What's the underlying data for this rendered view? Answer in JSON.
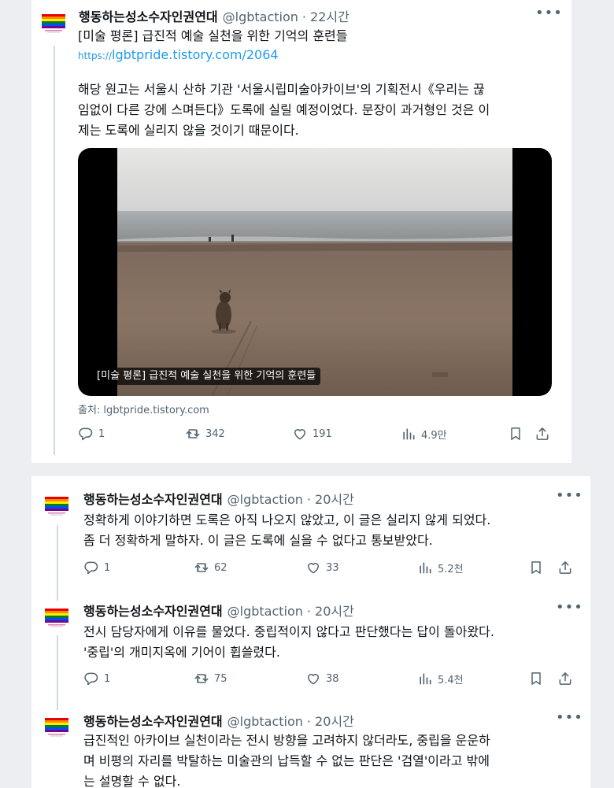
{
  "tweet1": {
    "name": "행동하는성소수자인권연대",
    "handle": "@lgbtaction",
    "time": "22시간",
    "title": "[미술 평론] 급진적 예술 실천을 위한 기억의 훈련들",
    "link_prefix": "https://",
    "link": "lgbtpride.tistory.com/2064",
    "body_line1": "해당 원고는 서울시 산하 기관 '서울시립미술아카이브'의 기획전시《우리는 끊",
    "body_line2": "임없이 다른 강에 스며든다》도록에 실릴 예정이었다. 문장이 과거형인 것은 이",
    "body_line3": "제는 도록에 실리지 않을 것이기 때문이다.",
    "media_caption": "[미술 평론] 급진적 예술 실천을 위한 기억의 훈련들",
    "source": "출처: lgbtpride.tistory.com",
    "replies": "1",
    "retweets": "342",
    "likes": "191",
    "views": "4.9만"
  },
  "tweet2": {
    "name": "행동하는성소수자인권연대",
    "handle": "@lgbtaction",
    "time": "20시간",
    "body_line1": "정확하게 이야기하면 도록은 아직 나오지 않았고, 이 글은 실리지 않게 되었다.",
    "body_line2": "좀 더 정확하게 말하자. 이 글은 도록에 실을 수 없다고 통보받았다.",
    "replies": "1",
    "retweets": "62",
    "likes": "33",
    "views": "5.2천"
  },
  "tweet3": {
    "name": "행동하는성소수자인권연대",
    "handle": "@lgbtaction",
    "time": "20시간",
    "body_line1": "전시 담당자에게 이유를 물었다. 중립적이지 않다고 판단했다는 답이 돌아왔다.",
    "body_line2": "'중립'의 개미지옥에 기어이 휩쓸렸다.",
    "replies": "1",
    "retweets": "75",
    "likes": "38",
    "views": "5.4천"
  },
  "tweet4": {
    "name": "행동하는성소수자인권연대",
    "handle": "@lgbtaction",
    "time": "20시간",
    "body_line1": "급진적인 아카이브 실천이라는 전시 방향을 고려하지 않더라도, 중립을 운운하",
    "body_line2": "며 비평의 자리를 박탈하는 미술관의 납득할 수 없는 판단은 '검열'이라고 밖에",
    "body_line3": "는 설명할 수 없다."
  },
  "colors": {
    "link": "#1d9bf0",
    "secondary_text": "#536471",
    "thread_line": "#cfd9de"
  }
}
